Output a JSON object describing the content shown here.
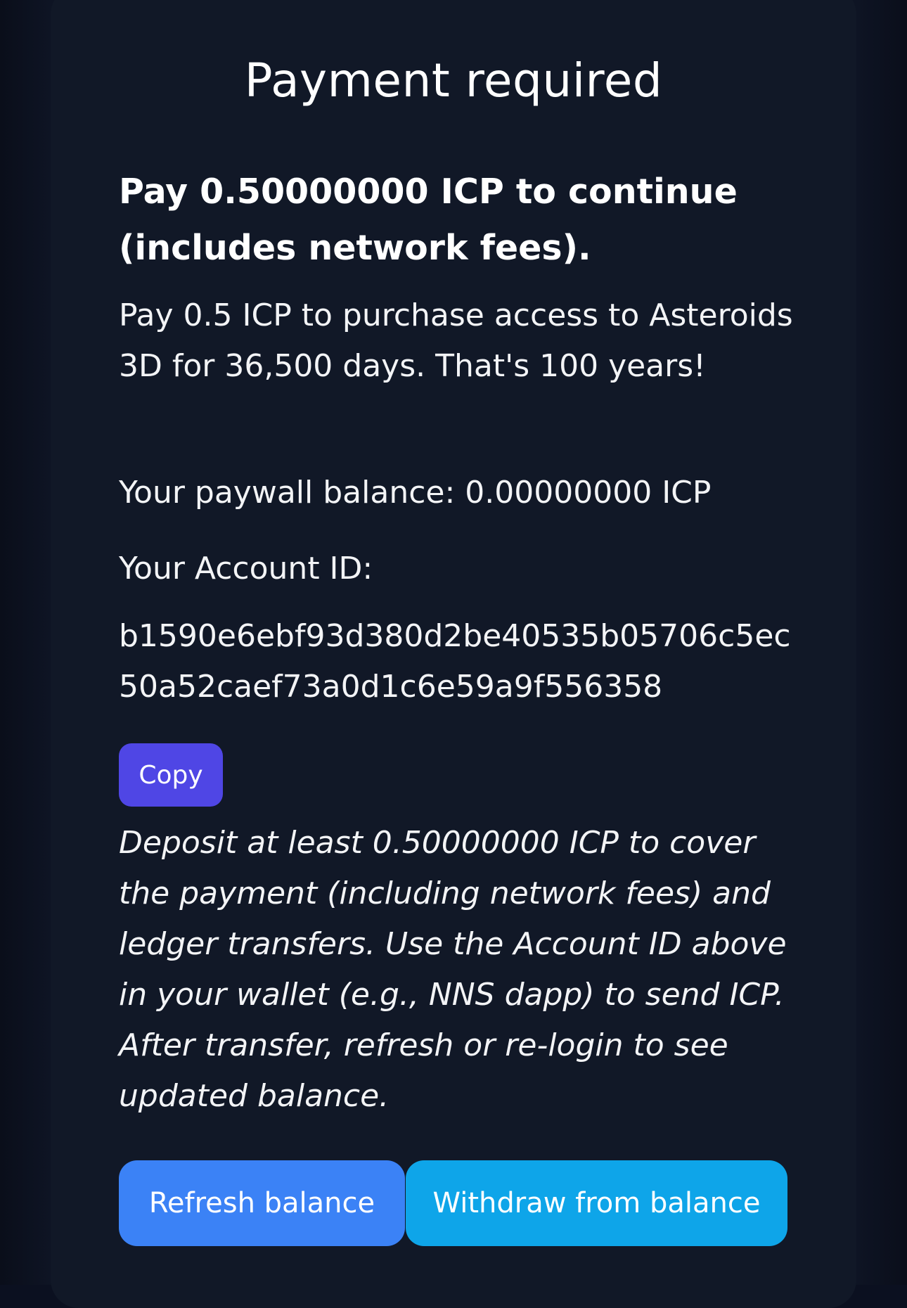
{
  "dialog": {
    "title": "Payment required",
    "lead": "Pay 0.50000000 ICP to continue (includes network fees).",
    "description": "Pay 0.5 ICP to purchase access to Asteroids 3D for 36,500 days. That's 100 years!",
    "balance_text": "Your paywall balance: 0.00000000 ICP",
    "account_label": "Your Account ID:",
    "account_id": "b1590e6ebf93d380d2be40535b05706c5ec50a52caef73a0d1c6e59a9f556358",
    "copy_label": "Copy",
    "note": "Deposit at least 0.50000000 ICP to cover the payment (including network fees) and ledger transfers. Use the Account ID above in your wallet (e.g., NNS dapp) to send ICP. After transfer, refresh or re-login to see updated balance.",
    "refresh_label": "Refresh balance",
    "withdraw_label": "Withdraw from balance"
  },
  "colors": {
    "panel_bg": "#111827",
    "copy_button": "#4f46e5",
    "refresh_button": "#3b82f6",
    "withdraw_button": "#0ea5e9"
  }
}
